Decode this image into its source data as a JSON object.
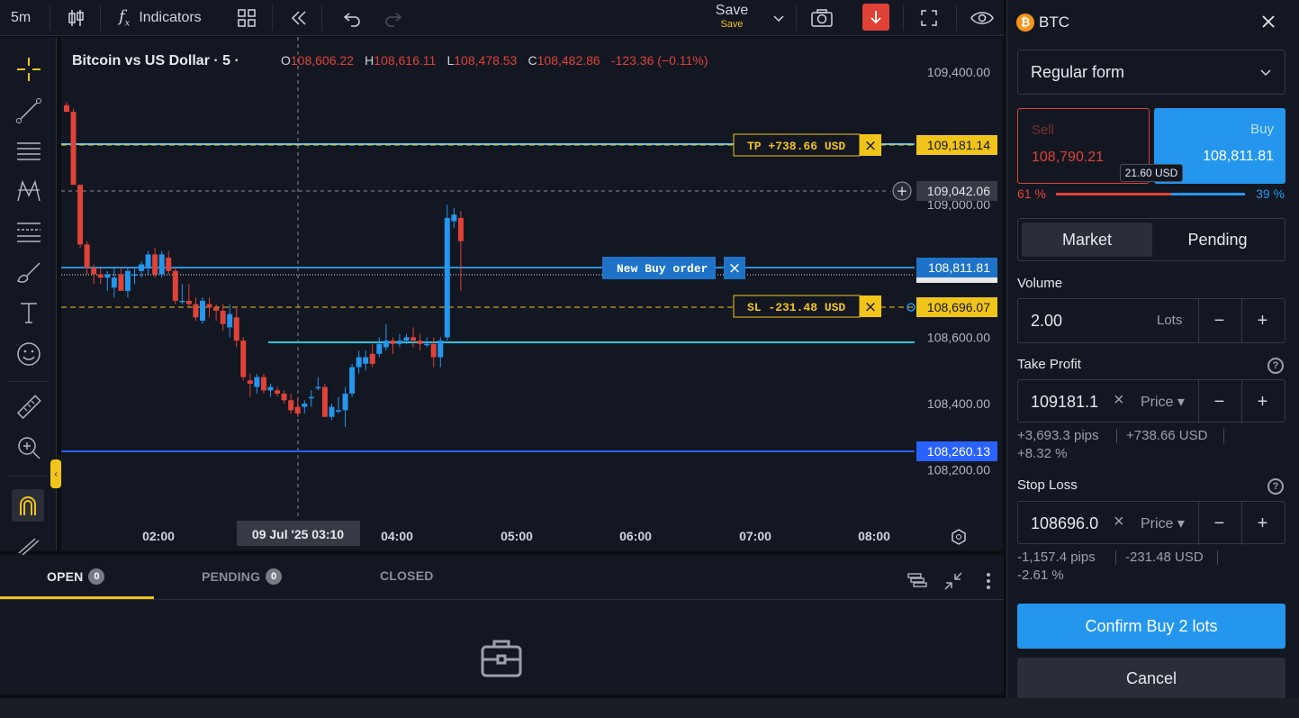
{
  "toolbar": {
    "timeframe": "5m",
    "indicators_label": "Indicators",
    "save_label": "Save",
    "save_sub": "Save"
  },
  "chart": {
    "symbol_title": "Bitcoin vs US Dollar · 5 ·",
    "ohlc": {
      "o_label": "O",
      "o": "108,606.22",
      "h_label": "H",
      "h": "108,616.11",
      "l_label": "L",
      "l": "108,478.53",
      "c_label": "C",
      "c": "108,482.86",
      "change": "-123.36 (−0.11%)"
    },
    "price_labels": [
      "109,400.00",
      "109,000.00",
      "108,600.00",
      "108,400.00",
      "108,200.00"
    ],
    "time_labels": [
      "02:00",
      "04:00",
      "05:00",
      "06:00",
      "07:00",
      "08:00"
    ],
    "crosshair_time": "09 Jul '25   03:10",
    "tags": {
      "tp_price": "109,181.14",
      "crosshair_price": "109,042.06",
      "buy_price": "108,811.81",
      "sl_price": "108,696.07",
      "blue_line_price": "108,260.13"
    },
    "tp_label": "TP +738.66 USD",
    "sl_label": "SL -231.48 USD",
    "new_order_label": "New Buy order",
    "colors": {
      "up": "#2496ee",
      "down": "#e04238",
      "tp": "#f0c419",
      "line": "#2f8fd8"
    }
  },
  "chart_data": {
    "type": "candlestick",
    "title": "Bitcoin vs US Dollar · 5 ·",
    "xlabel": "",
    "ylabel": "",
    "ylim": [
      108150,
      109470
    ],
    "candles": [
      {
        "o": 109300,
        "h": 109310,
        "l": 109280,
        "c": 109280
      },
      {
        "o": 109280,
        "h": 109290,
        "l": 109060,
        "c": 109060
      },
      {
        "o": 109060,
        "h": 109060,
        "l": 108870,
        "c": 108880
      },
      {
        "o": 108880,
        "h": 108890,
        "l": 108790,
        "c": 108810
      },
      {
        "o": 108810,
        "h": 108820,
        "l": 108760,
        "c": 108790
      },
      {
        "o": 108790,
        "h": 108810,
        "l": 108760,
        "c": 108780
      },
      {
        "o": 108780,
        "h": 108800,
        "l": 108740,
        "c": 108790
      },
      {
        "o": 108750,
        "h": 108810,
        "l": 108720,
        "c": 108780
      },
      {
        "o": 108790,
        "h": 108810,
        "l": 108740,
        "c": 108740
      },
      {
        "o": 108740,
        "h": 108810,
        "l": 108720,
        "c": 108800
      },
      {
        "o": 108790,
        "h": 108810,
        "l": 108760,
        "c": 108790
      },
      {
        "o": 108800,
        "h": 108830,
        "l": 108780,
        "c": 108820
      },
      {
        "o": 108810,
        "h": 108860,
        "l": 108790,
        "c": 108850
      },
      {
        "o": 108850,
        "h": 108870,
        "l": 108780,
        "c": 108790
      },
      {
        "o": 108790,
        "h": 108860,
        "l": 108780,
        "c": 108850
      },
      {
        "o": 108840,
        "h": 108860,
        "l": 108790,
        "c": 108800
      },
      {
        "o": 108800,
        "h": 108810,
        "l": 108700,
        "c": 108710
      },
      {
        "o": 108710,
        "h": 108760,
        "l": 108700,
        "c": 108710
      },
      {
        "o": 108710,
        "h": 108760,
        "l": 108690,
        "c": 108700
      },
      {
        "o": 108700,
        "h": 108720,
        "l": 108650,
        "c": 108660
      },
      {
        "o": 108650,
        "h": 108720,
        "l": 108640,
        "c": 108710
      },
      {
        "o": 108700,
        "h": 108720,
        "l": 108660,
        "c": 108690
      },
      {
        "o": 108690,
        "h": 108700,
        "l": 108650,
        "c": 108680
      },
      {
        "o": 108680,
        "h": 108700,
        "l": 108620,
        "c": 108640
      },
      {
        "o": 108630,
        "h": 108700,
        "l": 108600,
        "c": 108670
      },
      {
        "o": 108660,
        "h": 108690,
        "l": 108570,
        "c": 108590
      },
      {
        "o": 108590,
        "h": 108600,
        "l": 108470,
        "c": 108480
      },
      {
        "o": 108470,
        "h": 108490,
        "l": 108420,
        "c": 108460
      },
      {
        "o": 108450,
        "h": 108490,
        "l": 108430,
        "c": 108480
      },
      {
        "o": 108480,
        "h": 108490,
        "l": 108430,
        "c": 108440
      },
      {
        "o": 108440,
        "h": 108460,
        "l": 108420,
        "c": 108450
      },
      {
        "o": 108440,
        "h": 108450,
        "l": 108420,
        "c": 108430
      },
      {
        "o": 108430,
        "h": 108440,
        "l": 108400,
        "c": 108410
      },
      {
        "o": 108410,
        "h": 108430,
        "l": 108370,
        "c": 108380
      },
      {
        "o": 108390,
        "h": 108420,
        "l": 108360,
        "c": 108370
      },
      {
        "o": 108390,
        "h": 108410,
        "l": 108370,
        "c": 108400
      },
      {
        "o": 108420,
        "h": 108440,
        "l": 108390,
        "c": 108420
      },
      {
        "o": 108450,
        "h": 108480,
        "l": 108440,
        "c": 108450
      },
      {
        "o": 108450,
        "h": 108460,
        "l": 108360,
        "c": 108360
      },
      {
        "o": 108360,
        "h": 108400,
        "l": 108350,
        "c": 108390
      },
      {
        "o": 108380,
        "h": 108420,
        "l": 108370,
        "c": 108380
      },
      {
        "o": 108380,
        "h": 108450,
        "l": 108330,
        "c": 108430
      },
      {
        "o": 108430,
        "h": 108520,
        "l": 108420,
        "c": 108510
      },
      {
        "o": 108510,
        "h": 108560,
        "l": 108490,
        "c": 108540
      },
      {
        "o": 108520,
        "h": 108560,
        "l": 108500,
        "c": 108540
      },
      {
        "o": 108550,
        "h": 108580,
        "l": 108510,
        "c": 108520
      },
      {
        "o": 108550,
        "h": 108600,
        "l": 108540,
        "c": 108580
      },
      {
        "o": 108570,
        "h": 108640,
        "l": 108560,
        "c": 108590
      },
      {
        "o": 108590,
        "h": 108600,
        "l": 108550,
        "c": 108580
      },
      {
        "o": 108580,
        "h": 108610,
        "l": 108570,
        "c": 108590
      },
      {
        "o": 108590,
        "h": 108610,
        "l": 108580,
        "c": 108600
      },
      {
        "o": 108600,
        "h": 108630,
        "l": 108570,
        "c": 108590
      },
      {
        "o": 108590,
        "h": 108610,
        "l": 108560,
        "c": 108580
      },
      {
        "o": 108580,
        "h": 108600,
        "l": 108570,
        "c": 108580
      },
      {
        "o": 108580,
        "h": 108600,
        "l": 108510,
        "c": 108540
      },
      {
        "o": 108540,
        "h": 108600,
        "l": 108510,
        "c": 108590
      },
      {
        "o": 108600,
        "h": 109000,
        "l": 108590,
        "c": 108960
      },
      {
        "o": 108950,
        "h": 108990,
        "l": 108930,
        "c": 108970
      },
      {
        "o": 108960,
        "h": 108980,
        "l": 108740,
        "c": 108890
      }
    ]
  },
  "bottom": {
    "tab_open": "OPEN",
    "tab_open_count": "0",
    "tab_pending": "PENDING",
    "tab_pending_count": "0",
    "tab_closed": "CLOSED"
  },
  "panel": {
    "symbol": "BTC",
    "form_type": "Regular form",
    "sell_label": "Sell",
    "sell_price": "108,790.21",
    "buy_label": "Buy",
    "buy_price": "108,811.81",
    "spread": "21.60 USD",
    "sell_pct": "61 %",
    "buy_pct": "39 %",
    "sell_ratio": 0.61,
    "tab_market": "Market",
    "tab_pending": "Pending",
    "volume_label": "Volume",
    "volume_value": "2.00",
    "volume_unit": "Lots",
    "tp_label": "Take Profit",
    "tp_value": "109181.1",
    "tp_mode": "Price",
    "tp_pips": "+3,693.3 pips",
    "tp_usd": "+738.66 USD",
    "tp_pct": "+8.32 %",
    "sl_label": "Stop Loss",
    "sl_value": "108696.0",
    "sl_mode": "Price",
    "sl_pips": "-1,157.4 pips",
    "sl_usd": "-231.48 USD",
    "sl_pct": "-2.61 %",
    "confirm_label": "Confirm Buy 2 lots",
    "cancel_label": "Cancel"
  }
}
